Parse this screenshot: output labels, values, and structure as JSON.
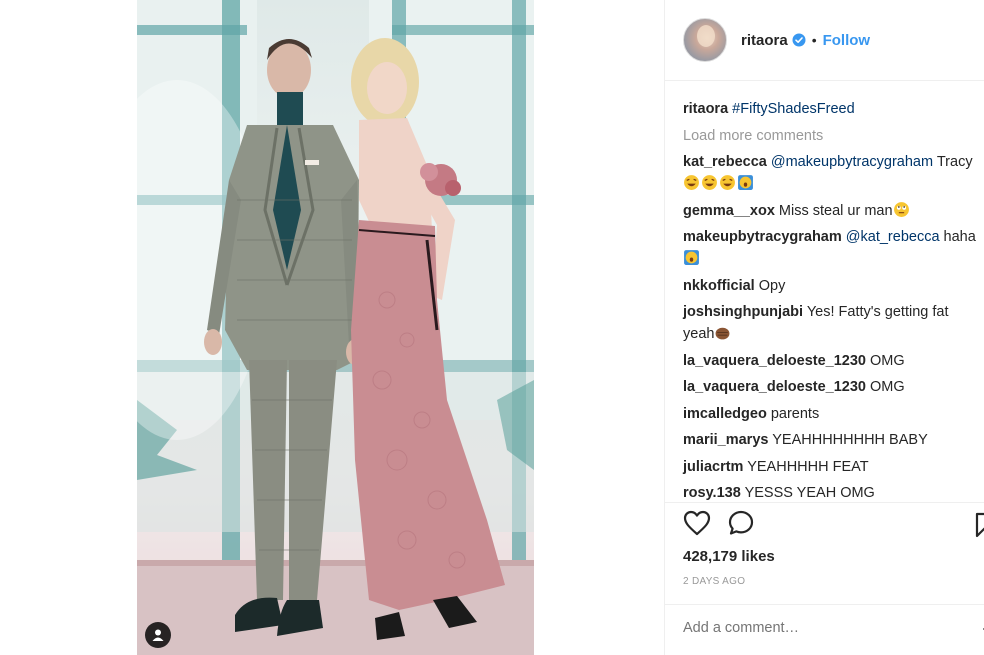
{
  "post": {
    "username": "ritaora",
    "follow_label": "Follow",
    "dot": "•",
    "caption": {
      "user": "ritaora",
      "hashtag": "#FiftyShadesFreed"
    },
    "load_more": "Load more comments",
    "comments": [
      {
        "user": "kat_rebecca",
        "mention": "@makeupbytracygraham",
        "text": " Tracy"
      },
      {
        "user": "gemma__xox",
        "text": "Miss steal ur man"
      },
      {
        "user": "makeupbytracygraham",
        "mention": "@kat_rebecca",
        "text": " haha"
      },
      {
        "user": "nkkofficial",
        "text": "Opy"
      },
      {
        "user": "joshsinghpunjabi",
        "text": "Yes! Fatty's getting fat yeah"
      },
      {
        "user": "la_vaquera_deloeste_1230",
        "text": "OMG"
      },
      {
        "user": "la_vaquera_deloeste_1230",
        "text": "OMG"
      },
      {
        "user": "imcalledgeo",
        "text": "parents"
      },
      {
        "user": "marii_marys",
        "text": "YEAHHHHHHHH BABY"
      },
      {
        "user": "juliacrtm",
        "text": "YEAHHHHH FEAT"
      },
      {
        "user": "rosy.138",
        "text": "YESSS YEAH OMG"
      }
    ],
    "likes": "428,179 likes",
    "time_ago": "2 DAYS AGO",
    "add_comment_placeholder": "Add a comment…",
    "more_options": "…"
  },
  "icons": {
    "verified": "verified-badge-icon",
    "like": "heart-icon",
    "comment": "comment-bubble-icon",
    "save": "bookmark-icon",
    "tagged": "user-tag-icon"
  },
  "colors": {
    "link_blue": "#3897f0",
    "mention_navy": "#003569",
    "muted_gray": "#999999",
    "text_dark": "#262626"
  }
}
